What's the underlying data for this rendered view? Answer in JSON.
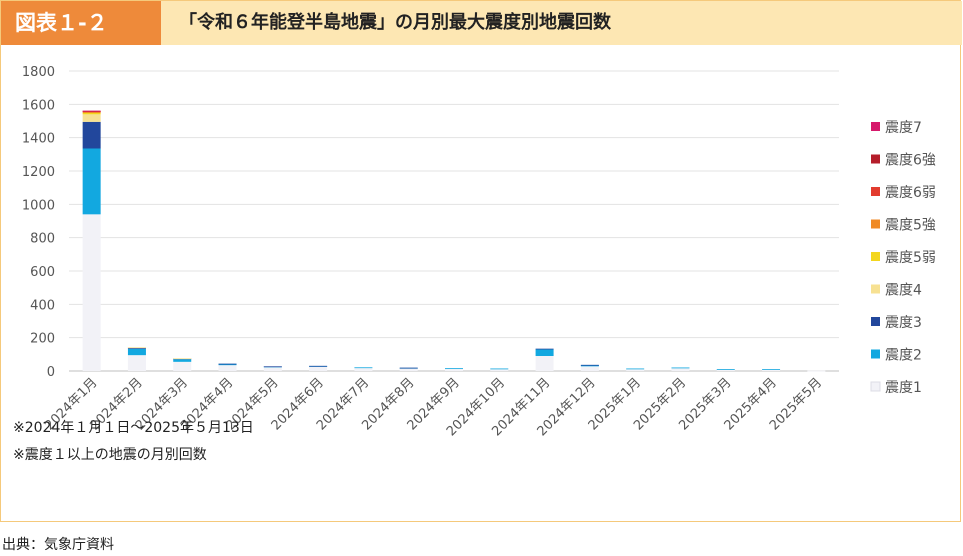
{
  "header": {
    "badge": "図表１-２",
    "title": "「令和６年能登半島地震」の月別最大震度別地震回数"
  },
  "notes": [
    "※2024年１月１日～2025年５月13日",
    "※震度１以上の地震の月別回数"
  ],
  "source": "出典：気象庁資料",
  "chart_data": {
    "type": "bar",
    "stacked": true,
    "categories": [
      "2024年1月",
      "2024年2月",
      "2024年3月",
      "2024年4月",
      "2024年5月",
      "2024年6月",
      "2024年7月",
      "2024年8月",
      "2024年9月",
      "2024年10月",
      "2024年11月",
      "2024年12月",
      "2025年1月",
      "2025年2月",
      "2025年3月",
      "2025年4月",
      "2025年5月"
    ],
    "ylim": [
      0,
      1800
    ],
    "yticks": [
      0,
      200,
      400,
      600,
      800,
      1000,
      1200,
      1400,
      1600,
      1800
    ],
    "grid": true,
    "legend_position": "right",
    "series": [
      {
        "name": "震度1",
        "color": "#f2f2f7",
        "values": [
          940,
          95,
          55,
          35,
          22,
          25,
          18,
          15,
          14,
          12,
          90,
          28,
          12,
          16,
          10,
          10,
          2
        ]
      },
      {
        "name": "震度2",
        "color": "#12a8e0",
        "values": [
          395,
          38,
          16,
          8,
          5,
          5,
          4,
          4,
          3,
          3,
          40,
          8,
          3,
          5,
          2,
          2,
          0
        ]
      },
      {
        "name": "震度3",
        "color": "#22479c",
        "values": [
          160,
          7,
          4,
          1,
          1,
          1,
          0,
          1,
          0,
          0,
          4,
          1,
          0,
          0,
          0,
          0,
          0
        ]
      },
      {
        "name": "震度4",
        "color": "#f7e192",
        "values": [
          45,
          2,
          1,
          0,
          0,
          0,
          0,
          0,
          0,
          0,
          0,
          0,
          0,
          0,
          0,
          0,
          0
        ]
      },
      {
        "name": "震度5弱",
        "color": "#f3d61e",
        "values": [
          8,
          0,
          0,
          0,
          0,
          0,
          0,
          0,
          0,
          0,
          0,
          0,
          0,
          0,
          0,
          0,
          0
        ]
      },
      {
        "name": "震度5強",
        "color": "#f08a24",
        "values": [
          8,
          0,
          0,
          0,
          0,
          0,
          0,
          0,
          0,
          0,
          0,
          0,
          0,
          0,
          0,
          0,
          0
        ]
      },
      {
        "name": "震度6弱",
        "color": "#e23b2e",
        "values": [
          3,
          0,
          0,
          0,
          0,
          0,
          0,
          0,
          0,
          0,
          0,
          0,
          0,
          0,
          0,
          0,
          0
        ]
      },
      {
        "name": "震度6強",
        "color": "#b51d2a",
        "values": [
          2,
          0,
          0,
          0,
          0,
          0,
          0,
          0,
          0,
          0,
          0,
          0,
          0,
          0,
          0,
          0,
          0
        ]
      },
      {
        "name": "震度7",
        "color": "#d6196b",
        "values": [
          1,
          0,
          0,
          0,
          0,
          0,
          0,
          0,
          0,
          0,
          0,
          0,
          0,
          0,
          0,
          0,
          0
        ]
      }
    ]
  }
}
